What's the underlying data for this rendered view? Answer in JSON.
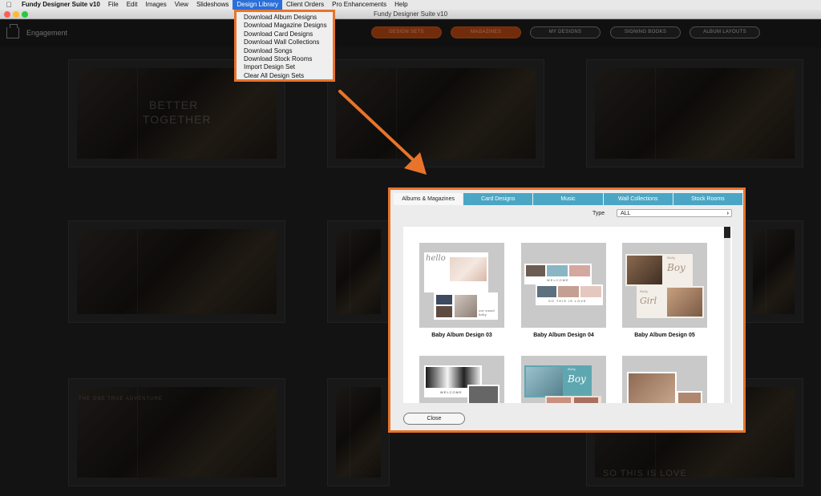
{
  "menubar": {
    "items": [
      "Fundy Designer Suite v10",
      "File",
      "Edit",
      "Images",
      "View",
      "Slideshows",
      "Design Library",
      "Client Orders",
      "Pro Enhancements",
      "Help"
    ]
  },
  "window": {
    "title": "Fundy Designer Suite v10"
  },
  "toolbar": {
    "project_name": "Engagement",
    "buttons": [
      "DESIGN SETS",
      "MAGAZINES",
      "MY DESIGNS",
      "SIGNING BOOKS",
      "ALBUM LAYOUTS"
    ]
  },
  "background": {
    "spread_text_1": "BETTER",
    "spread_text_2": "TOGETHER",
    "spread_text_3": "THE ONE TRUE ADVENTURE",
    "spread_text_4": "SO THIS IS LOVE"
  },
  "design_library_menu": {
    "items": [
      "Download Album Designs",
      "Download Magazine Designs",
      "Download Card Designs",
      "Download Wall Collections",
      "Download Songs",
      "Download Stock Rooms",
      "Import Design Set",
      "Clear All Design Sets"
    ]
  },
  "dialog": {
    "tabs": [
      "Albums & Magazines",
      "Card Designs",
      "Music",
      "Wall Collections",
      "Stock Rooms"
    ],
    "active_tab": "Albums & Magazines",
    "type_label": "Type",
    "type_value": "ALL",
    "designs": [
      {
        "name": "Baby Album Design 03"
      },
      {
        "name": "Baby Album Design 04"
      },
      {
        "name": "Baby Album Design 05"
      }
    ],
    "design_text": {
      "d3_word": "hello",
      "d3_script": "our sweet baby",
      "d4_welcome": "WELCOME",
      "d4_sub": "SO THIS IS LOVE",
      "d5_boy": "Boy",
      "d5_girl": "Girl",
      "d5_baby1": "Baby",
      "d5_baby2": "Baby",
      "d6_welcome": "WELCOME",
      "d7_boy": "Boy",
      "d7_baby": "Baby"
    },
    "close_label": "Close"
  }
}
